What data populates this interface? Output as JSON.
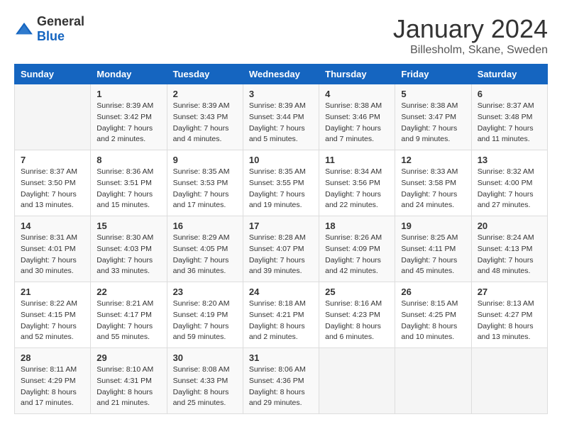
{
  "header": {
    "logo": {
      "general": "General",
      "blue": "Blue"
    },
    "title": "January 2024",
    "subtitle": "Billesholm, Skane, Sweden"
  },
  "days_of_week": [
    "Sunday",
    "Monday",
    "Tuesday",
    "Wednesday",
    "Thursday",
    "Friday",
    "Saturday"
  ],
  "weeks": [
    [
      {
        "day": null,
        "info": null
      },
      {
        "day": "1",
        "info": "Sunrise: 8:39 AM\nSunset: 3:42 PM\nDaylight: 7 hours\nand 2 minutes."
      },
      {
        "day": "2",
        "info": "Sunrise: 8:39 AM\nSunset: 3:43 PM\nDaylight: 7 hours\nand 4 minutes."
      },
      {
        "day": "3",
        "info": "Sunrise: 8:39 AM\nSunset: 3:44 PM\nDaylight: 7 hours\nand 5 minutes."
      },
      {
        "day": "4",
        "info": "Sunrise: 8:38 AM\nSunset: 3:46 PM\nDaylight: 7 hours\nand 7 minutes."
      },
      {
        "day": "5",
        "info": "Sunrise: 8:38 AM\nSunset: 3:47 PM\nDaylight: 7 hours\nand 9 minutes."
      },
      {
        "day": "6",
        "info": "Sunrise: 8:37 AM\nSunset: 3:48 PM\nDaylight: 7 hours\nand 11 minutes."
      }
    ],
    [
      {
        "day": "7",
        "info": "Sunrise: 8:37 AM\nSunset: 3:50 PM\nDaylight: 7 hours\nand 13 minutes."
      },
      {
        "day": "8",
        "info": "Sunrise: 8:36 AM\nSunset: 3:51 PM\nDaylight: 7 hours\nand 15 minutes."
      },
      {
        "day": "9",
        "info": "Sunrise: 8:35 AM\nSunset: 3:53 PM\nDaylight: 7 hours\nand 17 minutes."
      },
      {
        "day": "10",
        "info": "Sunrise: 8:35 AM\nSunset: 3:55 PM\nDaylight: 7 hours\nand 19 minutes."
      },
      {
        "day": "11",
        "info": "Sunrise: 8:34 AM\nSunset: 3:56 PM\nDaylight: 7 hours\nand 22 minutes."
      },
      {
        "day": "12",
        "info": "Sunrise: 8:33 AM\nSunset: 3:58 PM\nDaylight: 7 hours\nand 24 minutes."
      },
      {
        "day": "13",
        "info": "Sunrise: 8:32 AM\nSunset: 4:00 PM\nDaylight: 7 hours\nand 27 minutes."
      }
    ],
    [
      {
        "day": "14",
        "info": "Sunrise: 8:31 AM\nSunset: 4:01 PM\nDaylight: 7 hours\nand 30 minutes."
      },
      {
        "day": "15",
        "info": "Sunrise: 8:30 AM\nSunset: 4:03 PM\nDaylight: 7 hours\nand 33 minutes."
      },
      {
        "day": "16",
        "info": "Sunrise: 8:29 AM\nSunset: 4:05 PM\nDaylight: 7 hours\nand 36 minutes."
      },
      {
        "day": "17",
        "info": "Sunrise: 8:28 AM\nSunset: 4:07 PM\nDaylight: 7 hours\nand 39 minutes."
      },
      {
        "day": "18",
        "info": "Sunrise: 8:26 AM\nSunset: 4:09 PM\nDaylight: 7 hours\nand 42 minutes."
      },
      {
        "day": "19",
        "info": "Sunrise: 8:25 AM\nSunset: 4:11 PM\nDaylight: 7 hours\nand 45 minutes."
      },
      {
        "day": "20",
        "info": "Sunrise: 8:24 AM\nSunset: 4:13 PM\nDaylight: 7 hours\nand 48 minutes."
      }
    ],
    [
      {
        "day": "21",
        "info": "Sunrise: 8:22 AM\nSunset: 4:15 PM\nDaylight: 7 hours\nand 52 minutes."
      },
      {
        "day": "22",
        "info": "Sunrise: 8:21 AM\nSunset: 4:17 PM\nDaylight: 7 hours\nand 55 minutes."
      },
      {
        "day": "23",
        "info": "Sunrise: 8:20 AM\nSunset: 4:19 PM\nDaylight: 7 hours\nand 59 minutes."
      },
      {
        "day": "24",
        "info": "Sunrise: 8:18 AM\nSunset: 4:21 PM\nDaylight: 8 hours\nand 2 minutes."
      },
      {
        "day": "25",
        "info": "Sunrise: 8:16 AM\nSunset: 4:23 PM\nDaylight: 8 hours\nand 6 minutes."
      },
      {
        "day": "26",
        "info": "Sunrise: 8:15 AM\nSunset: 4:25 PM\nDaylight: 8 hours\nand 10 minutes."
      },
      {
        "day": "27",
        "info": "Sunrise: 8:13 AM\nSunset: 4:27 PM\nDaylight: 8 hours\nand 13 minutes."
      }
    ],
    [
      {
        "day": "28",
        "info": "Sunrise: 8:11 AM\nSunset: 4:29 PM\nDaylight: 8 hours\nand 17 minutes."
      },
      {
        "day": "29",
        "info": "Sunrise: 8:10 AM\nSunset: 4:31 PM\nDaylight: 8 hours\nand 21 minutes."
      },
      {
        "day": "30",
        "info": "Sunrise: 8:08 AM\nSunset: 4:33 PM\nDaylight: 8 hours\nand 25 minutes."
      },
      {
        "day": "31",
        "info": "Sunrise: 8:06 AM\nSunset: 4:36 PM\nDaylight: 8 hours\nand 29 minutes."
      },
      {
        "day": null,
        "info": null
      },
      {
        "day": null,
        "info": null
      },
      {
        "day": null,
        "info": null
      }
    ]
  ]
}
